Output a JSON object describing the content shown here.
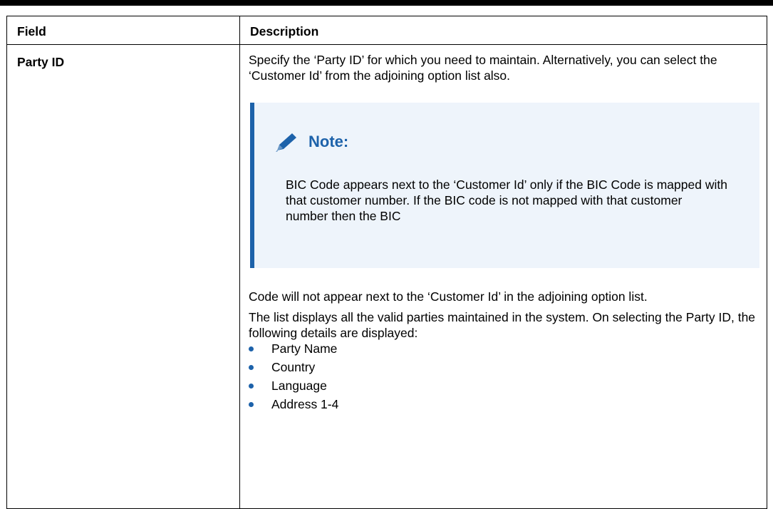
{
  "table": {
    "header_field": "Field",
    "header_description": "Description"
  },
  "row": {
    "field": "Party ID",
    "intro": "Specify the ‘Party ID’ for which you need to maintain. Alternatively, you can select the ‘Customer Id’ from the adjoining option list also.",
    "note": {
      "icon": "pencil-icon",
      "title": "Note:",
      "body": "BIC Code appears next to the ‘Customer Id’ only if the BIC Code is mapped with that customer number. If the BIC code is not mapped with that customer number then the BIC"
    },
    "continuation": "Code will not appear next to the ‘Customer Id’ in the adjoining option list.",
    "list_intro": "The list displays all the valid parties maintained in the system. On selecting the Party ID, the following details are displayed:",
    "details": [
      "Party Name",
      "Country",
      "Language",
      "Address 1-4"
    ]
  },
  "colors": {
    "accent": "#1d62aa",
    "note_background": "#eef4fb"
  }
}
